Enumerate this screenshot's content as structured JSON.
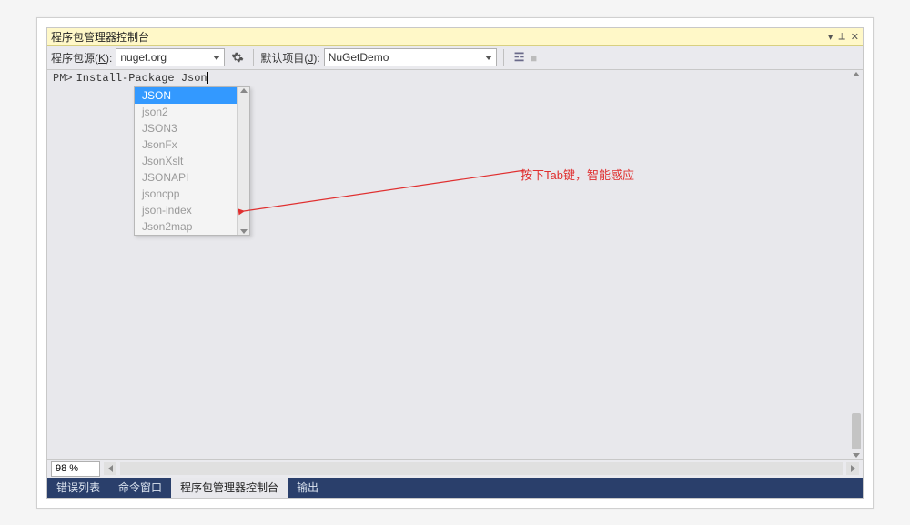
{
  "title_bar": {
    "title": "程序包管理器控制台"
  },
  "toolbar": {
    "source_label_pre": "程序包源(",
    "source_label_key": "K",
    "source_label_post": "):",
    "source_value": "nuget.org",
    "project_label_pre": "默认项目(",
    "project_label_key": "J",
    "project_label_post": "):",
    "project_value": "NuGetDemo"
  },
  "console": {
    "prompt": "PM>",
    "command": "Install-Package Json"
  },
  "intellisense": {
    "items": [
      "JSON",
      "json2",
      "JSON3",
      "JsonFx",
      "JsonXslt",
      "JSONAPI",
      "jsoncpp",
      "json-index",
      "Json2map"
    ]
  },
  "annotation": {
    "text": "按下Tab键，智能感应"
  },
  "status": {
    "zoom": "98 %"
  },
  "bottom_tabs": {
    "tab0": "错误列表",
    "tab1": "命令窗口",
    "tab2": "程序包管理器控制台",
    "tab3": "输出"
  }
}
